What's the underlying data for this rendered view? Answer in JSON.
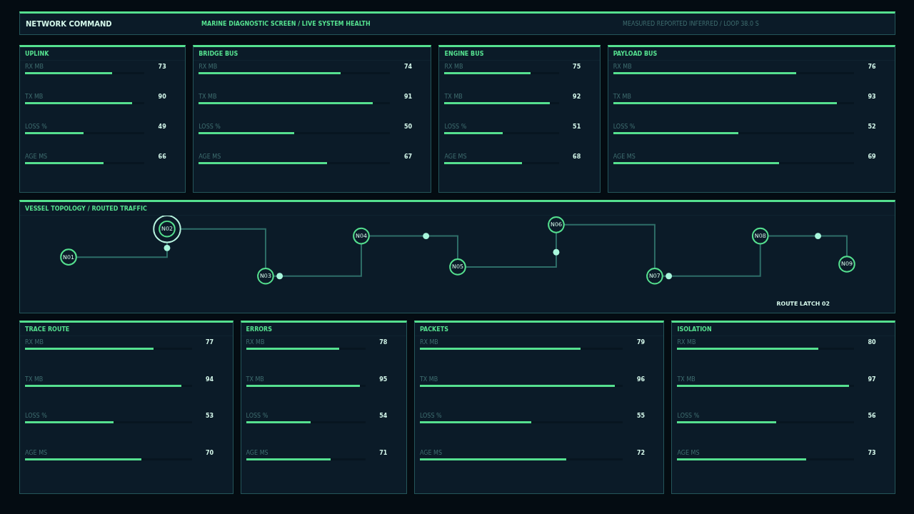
{
  "header": {
    "title": "NETWORK COMMAND",
    "subtitle": "MARINE DIAGNOSTIC SCREEN / LIVE SYSTEM HEALTH",
    "legend": "MEASURED REPORTED INFERRED / LOOP 38.0 S"
  },
  "top_panels": [
    {
      "title": "UPLINK",
      "metrics": [
        {
          "label": "RX MB",
          "value": "73",
          "level": 0.73
        },
        {
          "label": "TX MB",
          "value": "90",
          "level": 0.9
        },
        {
          "label": "LOSS %",
          "value": "49",
          "level": 0.49
        },
        {
          "label": "AGE MS",
          "value": "66",
          "level": 0.66
        }
      ]
    },
    {
      "title": "BRIDGE BUS",
      "metrics": [
        {
          "label": "RX MB",
          "value": "74",
          "level": 0.74
        },
        {
          "label": "TX MB",
          "value": "91",
          "level": 0.91
        },
        {
          "label": "LOSS %",
          "value": "50",
          "level": 0.5
        },
        {
          "label": "AGE MS",
          "value": "67",
          "level": 0.67
        }
      ]
    },
    {
      "title": "ENGINE BUS",
      "metrics": [
        {
          "label": "RX MB",
          "value": "75",
          "level": 0.75
        },
        {
          "label": "TX MB",
          "value": "92",
          "level": 0.92
        },
        {
          "label": "LOSS %",
          "value": "51",
          "level": 0.51
        },
        {
          "label": "AGE MS",
          "value": "68",
          "level": 0.68
        }
      ]
    },
    {
      "title": "PAYLOAD BUS",
      "metrics": [
        {
          "label": "RX MB",
          "value": "76",
          "level": 0.76
        },
        {
          "label": "TX MB",
          "value": "93",
          "level": 0.93
        },
        {
          "label": "LOSS %",
          "value": "52",
          "level": 0.52
        },
        {
          "label": "AGE MS",
          "value": "69",
          "level": 0.69
        }
      ]
    }
  ],
  "topology": {
    "title": "VESSEL TOPOLOGY / ROUTED TRAFFIC",
    "route_label": "ROUTE LATCH 02",
    "nodes": [
      {
        "label": "N01",
        "selected": false
      },
      {
        "label": "N02",
        "selected": true
      },
      {
        "label": "N03",
        "selected": false
      },
      {
        "label": "N04",
        "selected": false
      },
      {
        "label": "N05",
        "selected": false
      },
      {
        "label": "N06",
        "selected": false
      },
      {
        "label": "N07",
        "selected": false
      },
      {
        "label": "N08",
        "selected": false
      },
      {
        "label": "N09",
        "selected": false
      }
    ]
  },
  "bottom_panels": [
    {
      "title": "TRACE ROUTE",
      "metrics": [
        {
          "label": "RX MB",
          "value": "77",
          "level": 0.77
        },
        {
          "label": "TX MB",
          "value": "94",
          "level": 0.94
        },
        {
          "label": "LOSS %",
          "value": "53",
          "level": 0.53
        },
        {
          "label": "AGE MS",
          "value": "70",
          "level": 0.7
        }
      ]
    },
    {
      "title": "ERRORS",
      "metrics": [
        {
          "label": "RX MB",
          "value": "78",
          "level": 0.78
        },
        {
          "label": "TX MB",
          "value": "95",
          "level": 0.95
        },
        {
          "label": "LOSS %",
          "value": "54",
          "level": 0.54
        },
        {
          "label": "AGE MS",
          "value": "71",
          "level": 0.71
        }
      ]
    },
    {
      "title": "PACKETS",
      "metrics": [
        {
          "label": "RX MB",
          "value": "79",
          "level": 0.79
        },
        {
          "label": "TX MB",
          "value": "96",
          "level": 0.96
        },
        {
          "label": "LOSS %",
          "value": "55",
          "level": 0.55
        },
        {
          "label": "AGE MS",
          "value": "72",
          "level": 0.72
        }
      ]
    },
    {
      "title": "ISOLATION",
      "metrics": [
        {
          "label": "RX MB",
          "value": "80",
          "level": 0.8
        },
        {
          "label": "TX MB",
          "value": "97",
          "level": 0.97
        },
        {
          "label": "LOSS %",
          "value": "56",
          "level": 0.56
        },
        {
          "label": "AGE MS",
          "value": "73",
          "level": 0.73
        }
      ]
    }
  ]
}
